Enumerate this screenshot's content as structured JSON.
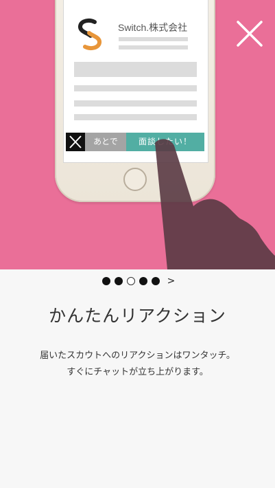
{
  "illustration": {
    "company_name": "Switch.株式会社",
    "later_button_label": "あとで",
    "interview_button_label": "面談したい！"
  },
  "pager": {
    "total_pages": 5,
    "current_page": 3,
    "next_label": ">"
  },
  "content": {
    "title": "かんたんリアクション",
    "description_line1": "届いたスカウトへのリアクションはワンタッチ。",
    "description_line2": "すぐにチャットが立ち上がります。"
  },
  "colors": {
    "hero_background": "#ea6f98",
    "accept_button": "#52aea3",
    "later_button": "#a4a4a4",
    "logo_orange": "#e8963a",
    "hand_shadow": "#6d3c4a"
  },
  "icons": {
    "close": "close-icon",
    "logo": "switch-logo-icon",
    "reject": "x-icon",
    "hand": "pointing-hand-icon"
  }
}
